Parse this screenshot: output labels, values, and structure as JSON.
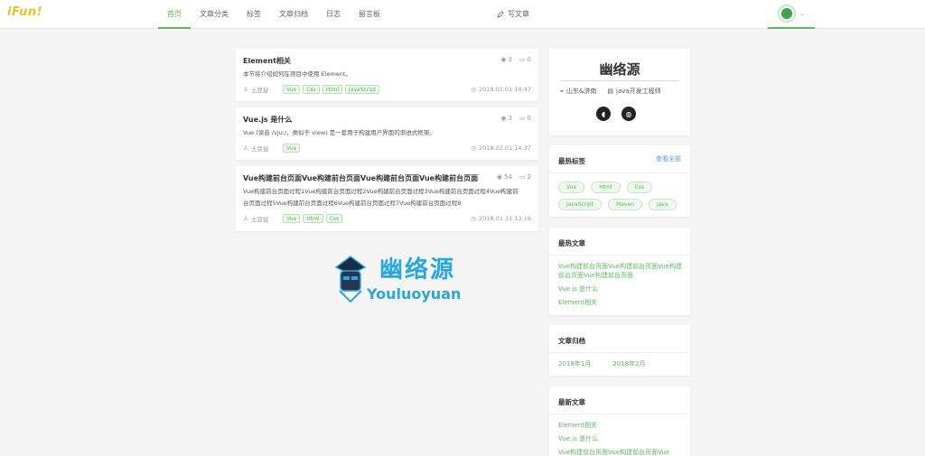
{
  "header": {
    "logo": "iFun!",
    "nav": [
      "首页",
      "文章分类",
      "标签",
      "文章归档",
      "日志",
      "留言板"
    ],
    "active_index": 0,
    "write_label": "写文章",
    "accent": "#5cb85c"
  },
  "articles": [
    {
      "title": "Element相关",
      "views": "3",
      "comments": "0",
      "desc": "本节将介绍如何在项目中使用 Element。",
      "author": "土豆鼠",
      "tags": [
        "Vue",
        "Css",
        "Html",
        "JavaScript"
      ],
      "date": "2018.02.01 14:47"
    },
    {
      "title": "Vue.js 是什么",
      "views": "3",
      "comments": "0",
      "desc": "Vue (读音 /vjuː/，类似于 view) 是一套用于构建用户界面的渐进式框架。",
      "author": "土豆鼠",
      "tags": [
        "Vue"
      ],
      "date": "2018.02.01 14:37"
    },
    {
      "title": "Vue构建前台页面Vue构建前台页面Vue构建前台页面Vue构建前台页面",
      "views": "54",
      "comments": "2",
      "desc_lines": [
        "Vue构建前台页面过程1Vue构建前台页面过程2Vue构建前台页面过程3Vue构建前台页面过程4Vue构建前",
        "台页面过程5Vue构建前台页面过程6Vue构建前台页面过程7Vue构建前台页面过程8"
      ],
      "author": "土豆鼠",
      "tags": [
        "Vue",
        "Html",
        "Css"
      ],
      "date": "2018.01.31 13:16"
    }
  ],
  "watermark": {
    "cn": "幽络源",
    "en": "Youluoyuan"
  },
  "profile": {
    "name": "幽络源",
    "location": "山东&济南",
    "job": "java开发工程师"
  },
  "hot_tags": {
    "title": "最热标签",
    "more": "查看全部",
    "tags": [
      "Vue",
      "Html",
      "Css",
      "JavaScript",
      "Maven",
      "Java"
    ]
  },
  "hot_articles": {
    "title": "最热文章",
    "items": [
      "Vue构建前台页面Vue构建前台页面Vue构建前台页面Vue构建前台页面",
      "Vue.js 是什么",
      "Element相关"
    ]
  },
  "archives": {
    "title": "文章归档",
    "items": [
      "2018年1月",
      "2018年2月"
    ]
  },
  "latest": {
    "title": "最新文章",
    "items": [
      "Element相关",
      "Vue.js 是什么",
      "Vue构建前台页面Vue构建前台页面Vue"
    ]
  }
}
